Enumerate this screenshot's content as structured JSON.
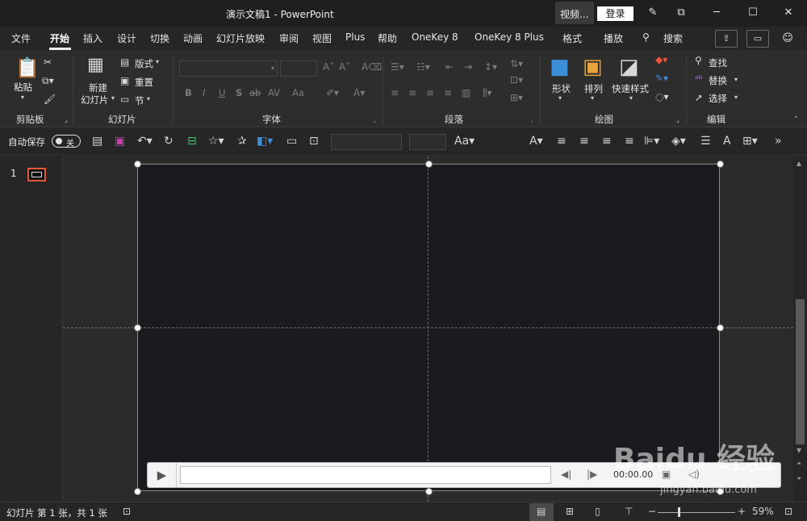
{
  "window": {
    "title": "演示文稿1  -  PowerPoint",
    "video_btn": "视频...",
    "login_btn": "登录",
    "pen_icon": "pen-icon",
    "restore_icon": "restore-icon",
    "minimize": "─",
    "maximize": "☐",
    "close": "✕"
  },
  "menu": {
    "tabs": [
      "文件",
      "开始",
      "插入",
      "设计",
      "切换",
      "动画",
      "幻灯片放映",
      "审阅",
      "视图",
      "Plus",
      "帮助",
      "OneKey 8",
      "OneKey 8 Plus",
      "格式",
      "播放"
    ],
    "active_tab": "开始",
    "search_label": "搜索"
  },
  "ribbon": {
    "clipboard": {
      "label": "剪贴板",
      "paste": "粘贴"
    },
    "slides": {
      "label": "幻灯片",
      "new_slide_1": "新建",
      "new_slide_2": "幻灯片",
      "layout": "版式",
      "reset": "重置",
      "section": "节"
    },
    "font": {
      "label": "字体",
      "bold": "B",
      "italic": "I",
      "underline": "U",
      "shadow": "S",
      "strike": "ab",
      "spacing": "AV",
      "case": "Aa"
    },
    "paragraph": {
      "label": "段落"
    },
    "drawing": {
      "label": "绘图",
      "shapes": "形状",
      "arrange": "排列",
      "quick_styles": "快速样式"
    },
    "editing": {
      "label": "编辑",
      "find": "查找",
      "replace": "替换",
      "select": "选择"
    }
  },
  "qat": {
    "autosave_label": "自动保存",
    "autosave_state": "关"
  },
  "thumbs": {
    "slide_number": "1"
  },
  "media": {
    "time": "00:00.00"
  },
  "status": {
    "slide_info": "幻灯片 第 1 张，共 1 张",
    "zoom": "59%",
    "zoom_minus": "−",
    "zoom_plus": "+"
  },
  "watermark": {
    "brand": "Baidu 经验",
    "url": "jingyan.baidu.com"
  },
  "colors": {
    "accent_thumb": "#e25a3a",
    "slide_bg": "#1b1b1f"
  }
}
